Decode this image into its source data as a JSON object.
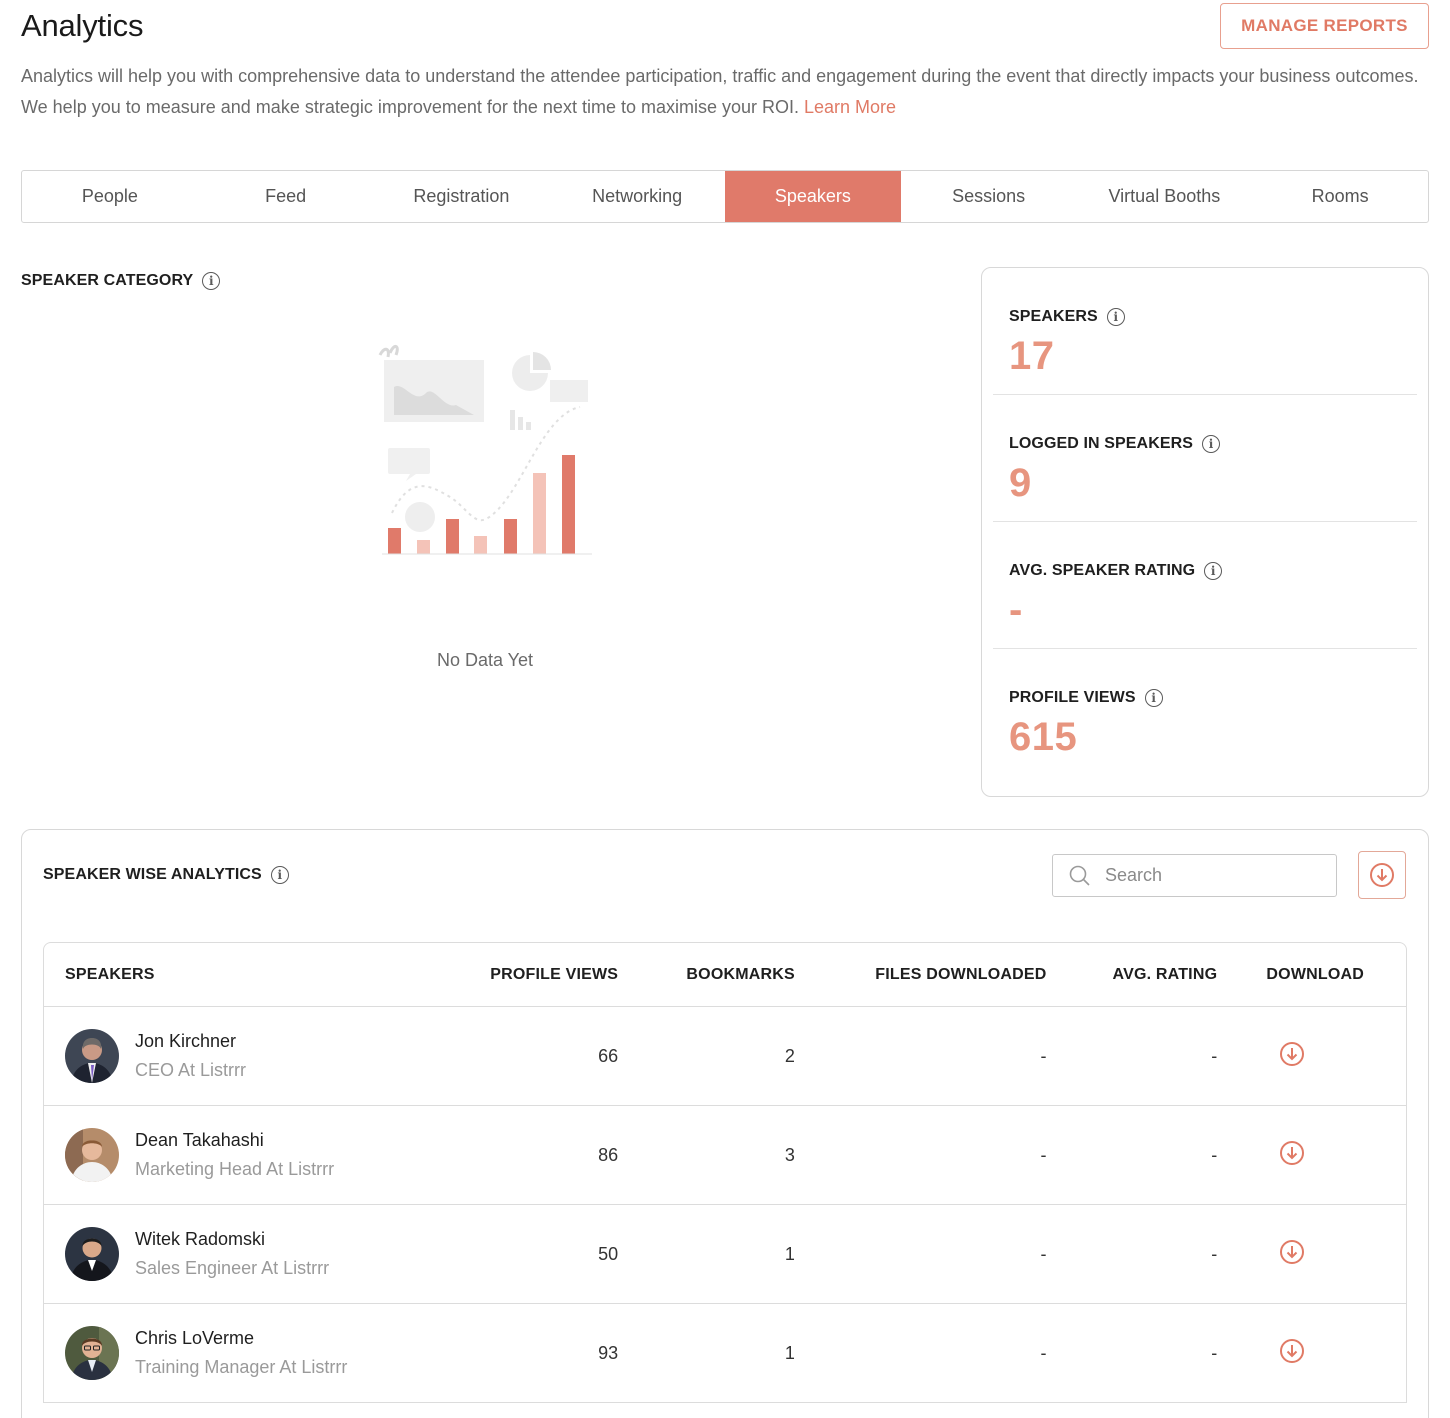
{
  "header": {
    "title": "Analytics",
    "manage_reports": "MANAGE REPORTS",
    "intro_text": "Analytics will help you with comprehensive data to understand the attendee participation, traffic and engagement during the event that directly impacts your business outcomes. We help you to measure and make strategic improvement for the next time to maximise your ROI. ",
    "learn_more": "Learn More"
  },
  "tabs": [
    "People",
    "Feed",
    "Registration",
    "Networking",
    "Speakers",
    "Sessions",
    "Virtual Booths",
    "Rooms"
  ],
  "active_tab": "Speakers",
  "speaker_category": {
    "title": "SPEAKER CATEGORY",
    "empty_text": "No Data Yet"
  },
  "stats": [
    {
      "label": "SPEAKERS",
      "value": "17"
    },
    {
      "label": "LOGGED IN SPEAKERS",
      "value": "9"
    },
    {
      "label": "AVG. SPEAKER RATING",
      "value": "-"
    },
    {
      "label": "PROFILE VIEWS",
      "value": "615"
    }
  ],
  "speaker_wise": {
    "title": "SPEAKER WISE ANALYTICS",
    "search_placeholder": "Search",
    "columns": [
      "SPEAKERS",
      "PROFILE VIEWS",
      "BOOKMARKS",
      "FILES DOWNLOADED",
      "AVG. RATING",
      "DOWNLOAD"
    ],
    "rows": [
      {
        "name": "Jon Kirchner",
        "role": "CEO At Listrrr",
        "profile_views": "66",
        "bookmarks": "2",
        "files_downloaded": "-",
        "avg_rating": "-"
      },
      {
        "name": "Dean Takahashi",
        "role": "Marketing Head At Listrrr",
        "profile_views": "86",
        "bookmarks": "3",
        "files_downloaded": "-",
        "avg_rating": "-"
      },
      {
        "name": "Witek Radomski",
        "role": "Sales Engineer At Listrrr",
        "profile_views": "50",
        "bookmarks": "1",
        "files_downloaded": "-",
        "avg_rating": "-"
      },
      {
        "name": "Chris LoVerme",
        "role": "Training Manager At Listrrr",
        "profile_views": "93",
        "bookmarks": "1",
        "files_downloaded": "-",
        "avg_rating": "-"
      }
    ]
  },
  "colors": {
    "accent": "#e07a6a",
    "stat_value": "#e7957f",
    "border": "#d8d8d8"
  }
}
